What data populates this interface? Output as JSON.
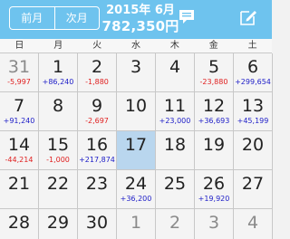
{
  "header": {
    "prev_label": "前月",
    "next_label": "次月",
    "year_month": "2015年 6月",
    "total": "782,350円"
  },
  "weekdays": [
    "日",
    "月",
    "火",
    "水",
    "木",
    "金",
    "土"
  ],
  "weeks": [
    [
      {
        "day": "31",
        "amount": "-5,997",
        "type": "neg",
        "other": true
      },
      {
        "day": "1",
        "amount": "+86,240",
        "type": "pos"
      },
      {
        "day": "2",
        "amount": "-1,880",
        "type": "neg"
      },
      {
        "day": "3",
        "amount": "",
        "type": ""
      },
      {
        "day": "4",
        "amount": "",
        "type": ""
      },
      {
        "day": "5",
        "amount": "-23,880",
        "type": "neg"
      },
      {
        "day": "6",
        "amount": "+299,654",
        "type": "pos"
      }
    ],
    [
      {
        "day": "7",
        "amount": "+91,240",
        "type": "pos"
      },
      {
        "day": "8",
        "amount": "",
        "type": ""
      },
      {
        "day": "9",
        "amount": "-2,697",
        "type": "neg"
      },
      {
        "day": "10",
        "amount": "",
        "type": ""
      },
      {
        "day": "11",
        "amount": "+23,000",
        "type": "pos"
      },
      {
        "day": "12",
        "amount": "+36,693",
        "type": "pos"
      },
      {
        "day": "13",
        "amount": "+45,199",
        "type": "pos"
      }
    ],
    [
      {
        "day": "14",
        "amount": "-44,214",
        "type": "neg"
      },
      {
        "day": "15",
        "amount": "-1,000",
        "type": "neg"
      },
      {
        "day": "16",
        "amount": "+217,874",
        "type": "pos"
      },
      {
        "day": "17",
        "amount": "",
        "type": "",
        "today": true
      },
      {
        "day": "18",
        "amount": "",
        "type": ""
      },
      {
        "day": "19",
        "amount": "",
        "type": ""
      },
      {
        "day": "20",
        "amount": "",
        "type": ""
      }
    ],
    [
      {
        "day": "21",
        "amount": "",
        "type": ""
      },
      {
        "day": "22",
        "amount": "",
        "type": ""
      },
      {
        "day": "23",
        "amount": "",
        "type": ""
      },
      {
        "day": "24",
        "amount": "+36,200",
        "type": "pos"
      },
      {
        "day": "25",
        "amount": "",
        "type": ""
      },
      {
        "day": "26",
        "amount": "+19,920",
        "type": "pos"
      },
      {
        "day": "27",
        "amount": "",
        "type": ""
      }
    ],
    [
      {
        "day": "28",
        "amount": "",
        "type": ""
      },
      {
        "day": "29",
        "amount": "",
        "type": ""
      },
      {
        "day": "30",
        "amount": "",
        "type": ""
      },
      {
        "day": "1",
        "amount": "",
        "type": "",
        "other": true
      },
      {
        "day": "2",
        "amount": "",
        "type": "",
        "other": true
      },
      {
        "day": "3",
        "amount": "",
        "type": "",
        "other": true
      },
      {
        "day": "4",
        "amount": "",
        "type": "",
        "other": true
      }
    ]
  ],
  "colors": {
    "header_bg": "#6ec3ee",
    "negative": "#e02020",
    "positive": "#2020c8",
    "today_bg": "#b9d6ee"
  },
  "icons": {
    "memo": "speech-bubble-icon",
    "edit": "edit-square-icon"
  }
}
